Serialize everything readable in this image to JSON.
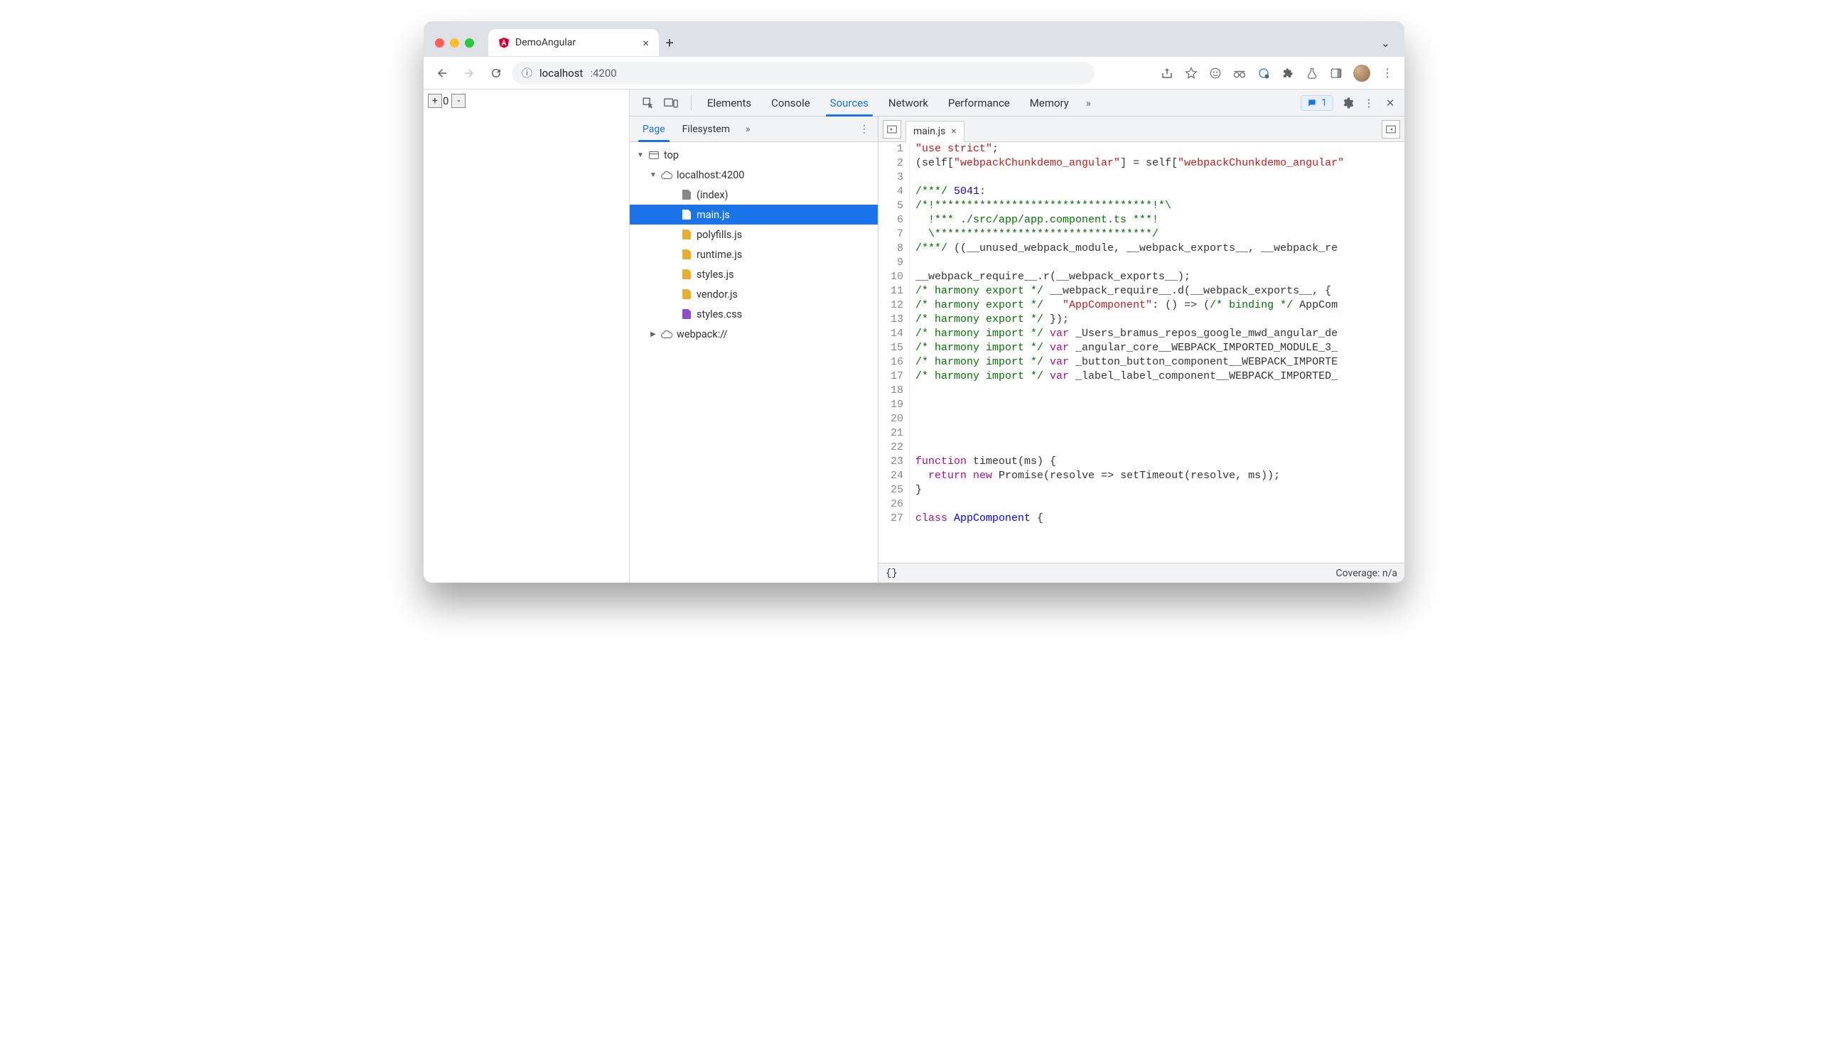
{
  "browser": {
    "tab_title": "DemoAngular",
    "url_host": "localhost",
    "url_port": ":4200"
  },
  "page": {
    "counter_value": "0",
    "plus": "+",
    "minus": "-"
  },
  "devtools": {
    "tabs": [
      "Elements",
      "Console",
      "Sources",
      "Network",
      "Performance",
      "Memory"
    ],
    "active_tab": "Sources",
    "issues_count": "1"
  },
  "sources": {
    "nav_tabs": [
      "Page",
      "Filesystem"
    ],
    "active_nav_tab": "Page",
    "tree": {
      "top": "top",
      "origin": "localhost:4200",
      "files": [
        {
          "name": "(index)",
          "kind": "doc"
        },
        {
          "name": "main.js",
          "kind": "js",
          "selected": true
        },
        {
          "name": "polyfills.js",
          "kind": "js"
        },
        {
          "name": "runtime.js",
          "kind": "js"
        },
        {
          "name": "styles.js",
          "kind": "js"
        },
        {
          "name": "vendor.js",
          "kind": "js"
        },
        {
          "name": "styles.css",
          "kind": "css"
        }
      ],
      "webpack": "webpack://"
    },
    "open_file": "main.js",
    "coverage": "Coverage: n/a",
    "format_label": "{}",
    "code_lines": [
      {
        "n": 1,
        "segs": [
          {
            "t": "\"use strict\"",
            "c": "s-r"
          },
          {
            "t": ";"
          }
        ]
      },
      {
        "n": 2,
        "segs": [
          {
            "t": "(self["
          },
          {
            "t": "\"webpackChunkdemo_angular\"",
            "c": "s-r"
          },
          {
            "t": "] = self["
          },
          {
            "t": "\"webpackChunkdemo_angular\"",
            "c": "s-r"
          }
        ]
      },
      {
        "n": 3,
        "segs": [
          {
            "t": ""
          }
        ]
      },
      {
        "n": 4,
        "segs": [
          {
            "t": "/***/ ",
            "c": "s-g"
          },
          {
            "t": "5041",
            "c": "s-n"
          },
          {
            "t": ":"
          }
        ]
      },
      {
        "n": 5,
        "segs": [
          {
            "t": "/*!**********************************!*\\",
            "c": "s-g"
          }
        ]
      },
      {
        "n": 6,
        "segs": [
          {
            "t": "  !*** ./src/app/app.component.ts ***!",
            "c": "s-g"
          }
        ]
      },
      {
        "n": 7,
        "segs": [
          {
            "t": "  \\**********************************/",
            "c": "s-g"
          }
        ]
      },
      {
        "n": 8,
        "segs": [
          {
            "t": "/***/ ",
            "c": "s-g"
          },
          {
            "t": "((__unused_webpack_module, __webpack_exports__, __webpack_re"
          }
        ]
      },
      {
        "n": 9,
        "segs": [
          {
            "t": ""
          }
        ]
      },
      {
        "n": 10,
        "segs": [
          {
            "t": "__webpack_require__.r(__webpack_exports__);"
          }
        ]
      },
      {
        "n": 11,
        "segs": [
          {
            "t": "/* harmony export */ ",
            "c": "s-g"
          },
          {
            "t": "__webpack_require__.d(__webpack_exports__, {"
          }
        ]
      },
      {
        "n": 12,
        "segs": [
          {
            "t": "/* harmony export */   ",
            "c": "s-g"
          },
          {
            "t": "\"AppComponent\"",
            "c": "s-r"
          },
          {
            "t": ": () => ("
          },
          {
            "t": "/* binding */ ",
            "c": "s-g"
          },
          {
            "t": "AppCom"
          }
        ]
      },
      {
        "n": 13,
        "segs": [
          {
            "t": "/* harmony export */ ",
            "c": "s-g"
          },
          {
            "t": "});"
          }
        ]
      },
      {
        "n": 14,
        "segs": [
          {
            "t": "/* harmony import */ ",
            "c": "s-g"
          },
          {
            "t": "var ",
            "c": "s-p"
          },
          {
            "t": "_Users_bramus_repos_google_mwd_angular_de"
          }
        ]
      },
      {
        "n": 15,
        "segs": [
          {
            "t": "/* harmony import */ ",
            "c": "s-g"
          },
          {
            "t": "var ",
            "c": "s-p"
          },
          {
            "t": "_angular_core__WEBPACK_IMPORTED_MODULE_3_"
          }
        ]
      },
      {
        "n": 16,
        "segs": [
          {
            "t": "/* harmony import */ ",
            "c": "s-g"
          },
          {
            "t": "var ",
            "c": "s-p"
          },
          {
            "t": "_button_button_component__WEBPACK_IMPORTE"
          }
        ]
      },
      {
        "n": 17,
        "segs": [
          {
            "t": "/* harmony import */ ",
            "c": "s-g"
          },
          {
            "t": "var ",
            "c": "s-p"
          },
          {
            "t": "_label_label_component__WEBPACK_IMPORTED_"
          }
        ]
      },
      {
        "n": 18,
        "segs": [
          {
            "t": ""
          }
        ]
      },
      {
        "n": 19,
        "segs": [
          {
            "t": ""
          }
        ]
      },
      {
        "n": 20,
        "segs": [
          {
            "t": ""
          }
        ]
      },
      {
        "n": 21,
        "segs": [
          {
            "t": ""
          }
        ]
      },
      {
        "n": 22,
        "segs": [
          {
            "t": ""
          }
        ]
      },
      {
        "n": 23,
        "segs": [
          {
            "t": "function ",
            "c": "s-p"
          },
          {
            "t": "timeout(ms) {"
          }
        ]
      },
      {
        "n": 24,
        "segs": [
          {
            "t": "  "
          },
          {
            "t": "return ",
            "c": "s-p"
          },
          {
            "t": "new ",
            "c": "s-p"
          },
          {
            "t": "Promise(resolve => setTimeout(resolve, ms));"
          }
        ]
      },
      {
        "n": 25,
        "segs": [
          {
            "t": "}"
          }
        ]
      },
      {
        "n": 26,
        "segs": [
          {
            "t": ""
          }
        ]
      },
      {
        "n": 27,
        "segs": [
          {
            "t": "class ",
            "c": "s-p"
          },
          {
            "t": "AppComponent ",
            "c": "s-b"
          },
          {
            "t": "{"
          }
        ]
      }
    ]
  }
}
